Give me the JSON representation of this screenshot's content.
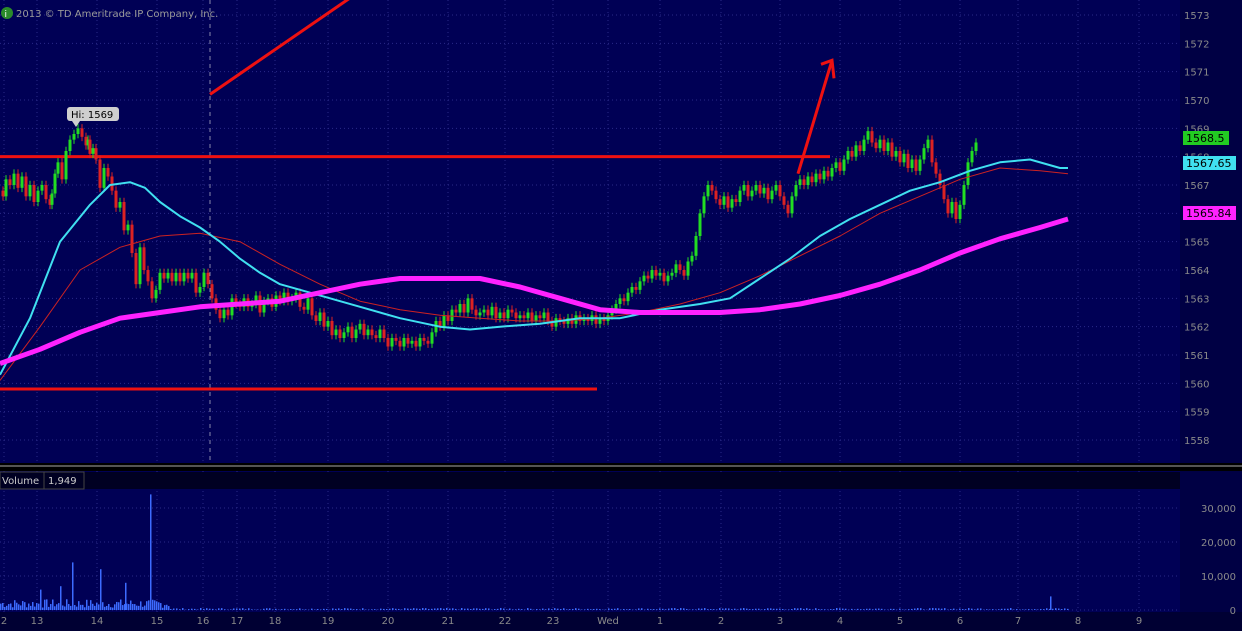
{
  "copyright": "2013 © TD Ameritrade IP Company, Inc.",
  "colors": {
    "background": "#000055",
    "grid": "#2a2a88",
    "axis_text": "#8a8a8a",
    "up_bar": "#22dd22",
    "down_bar": "#dd2222",
    "ma_fast": "#40e0f0",
    "ma_mid": "#cc2222",
    "ma_slow": "#ff22ff",
    "annotation": "#ee1111",
    "volume": "#3d6bff"
  },
  "hi_label": "Hi: 1569",
  "volume_panel": {
    "label": "Volume",
    "value": "1,949"
  },
  "price_badges": [
    {
      "text": "1568.5",
      "bg": "#22cc22",
      "fg": "#000000"
    },
    {
      "text": "1567.65",
      "bg": "#40e0f0",
      "fg": "#000000"
    },
    {
      "text": "1565.84",
      "bg": "#ff22ff",
      "fg": "#000000"
    }
  ],
  "chart_data": [
    {
      "type": "candlestick-with-moving-averages",
      "title": "",
      "y_axis": {
        "side": "right",
        "range": [
          1557.2,
          1573.5
        ],
        "ticks": [
          "1573",
          "1572",
          "1571",
          "1570",
          "1569",
          "1568",
          "1567",
          "1566",
          "1565",
          "1564",
          "1563",
          "1562",
          "1561",
          "1560",
          "1559",
          "1558"
        ]
      },
      "x_axis": {
        "labels": [
          "2",
          "13",
          "14",
          "15",
          "16",
          "17",
          "18",
          "19",
          "20",
          "21",
          "22",
          "23",
          "Wed",
          "1",
          "2",
          "3",
          "4",
          "5",
          "6",
          "7",
          "8",
          "9"
        ]
      },
      "price_path": {
        "x_bars": [
          0,
          3,
          6,
          10,
          14,
          18,
          22,
          26,
          30,
          34,
          38,
          42,
          46,
          50,
          52,
          55,
          58,
          62,
          66,
          70,
          74,
          78,
          82,
          86,
          88,
          90,
          93,
          96,
          100,
          104,
          108,
          112,
          116,
          120,
          124,
          128,
          132,
          136,
          140,
          144,
          148,
          152,
          156,
          160,
          164,
          168,
          172,
          176,
          180,
          184,
          188,
          192,
          196,
          200,
          204,
          208,
          212,
          216,
          220,
          224,
          228,
          232,
          236,
          240,
          244,
          248,
          252,
          256,
          260,
          264,
          268,
          272,
          276,
          280,
          284,
          288,
          292,
          296,
          300,
          304,
          308,
          312,
          316,
          320,
          324,
          328,
          332,
          336,
          340,
          344,
          348,
          352,
          356,
          360,
          364,
          368,
          372,
          376,
          380,
          384,
          388,
          392,
          396,
          400,
          404,
          408,
          412,
          416,
          420,
          424,
          428,
          432,
          436,
          440,
          444,
          448,
          452,
          456,
          460,
          464,
          468,
          472,
          476,
          480,
          484,
          488,
          492,
          496,
          500,
          504,
          508,
          512,
          516,
          520,
          524,
          528,
          532,
          536,
          540,
          544,
          548,
          552,
          556,
          560,
          564,
          568,
          572,
          576,
          580,
          584,
          588,
          592,
          596,
          600,
          604,
          608,
          612,
          616,
          620,
          624,
          628,
          632,
          636,
          640,
          644,
          648,
          652,
          656,
          660,
          664,
          668,
          672,
          676,
          680,
          684,
          688,
          692,
          696,
          700,
          704,
          708,
          712,
          716,
          720,
          724,
          728,
          732,
          736,
          740,
          744,
          748,
          752,
          756,
          760,
          764,
          768,
          772,
          776,
          780,
          784,
          788,
          792,
          796,
          800,
          804,
          808,
          812,
          816,
          820,
          824,
          828,
          832,
          836,
          840,
          844,
          848,
          852,
          856,
          860,
          864,
          868,
          872,
          876,
          880,
          884,
          888,
          892,
          896,
          900,
          904,
          908,
          912,
          916,
          920,
          924,
          928,
          932,
          936,
          940,
          944,
          948,
          952,
          956,
          960,
          964,
          968,
          972,
          976,
          980,
          984,
          988,
          992,
          996,
          1000,
          1004,
          1008,
          1012,
          1016,
          1020,
          1024,
          1028,
          1032,
          1036,
          1040,
          1044,
          1048,
          1052,
          1056,
          1060,
          1064,
          1068
        ],
        "closes": [
          1566.8,
          1566.6,
          1567.2,
          1567.0,
          1567.4,
          1566.9,
          1567.3,
          1566.6,
          1567.0,
          1566.4,
          1566.8,
          1567.0,
          1566.5,
          1566.3,
          1566.7,
          1567.4,
          1567.8,
          1567.2,
          1568.2,
          1568.6,
          1568.8,
          1569.0,
          1568.7,
          1568.4,
          1568.6,
          1568.1,
          1568.3,
          1567.9,
          1566.9,
          1567.6,
          1567.3,
          1566.8,
          1566.2,
          1566.4,
          1565.4,
          1565.6,
          1564.6,
          1563.5,
          1564.8,
          1564.0,
          1563.6,
          1563.0,
          1563.3,
          1563.9,
          1563.7,
          1563.9,
          1563.6,
          1563.9,
          1563.6,
          1563.9,
          1563.7,
          1563.9,
          1563.2,
          1563.4,
          1563.9,
          1563.5,
          1563.0,
          1562.6,
          1562.3,
          1562.6,
          1562.4,
          1563.0,
          1562.8,
          1562.7,
          1563.0,
          1562.7,
          1562.8,
          1563.1,
          1562.5,
          1562.9,
          1563.0,
          1562.7,
          1563.1,
          1562.9,
          1563.2,
          1562.9,
          1563.0,
          1563.2,
          1562.7,
          1562.6,
          1563.0,
          1562.4,
          1562.2,
          1562.5,
          1562.0,
          1562.2,
          1561.7,
          1561.9,
          1561.6,
          1561.8,
          1562.0,
          1561.6,
          1561.9,
          1562.1,
          1561.7,
          1561.9,
          1561.7,
          1561.6,
          1561.9,
          1561.6,
          1561.3,
          1561.6,
          1561.5,
          1561.3,
          1561.6,
          1561.4,
          1561.5,
          1561.3,
          1561.6,
          1561.5,
          1561.4,
          1561.8,
          1562.2,
          1562.0,
          1562.4,
          1562.2,
          1562.6,
          1562.5,
          1562.8,
          1562.5,
          1563.0,
          1562.6,
          1562.4,
          1562.5,
          1562.6,
          1562.4,
          1562.7,
          1562.3,
          1562.5,
          1562.3,
          1562.6,
          1562.5,
          1562.3,
          1562.4,
          1562.3,
          1562.5,
          1562.2,
          1562.4,
          1562.3,
          1562.5,
          1562.2,
          1562.0,
          1562.3,
          1562.2,
          1562.1,
          1562.3,
          1562.1,
          1562.4,
          1562.2,
          1562.3,
          1562.2,
          1562.4,
          1562.1,
          1562.3,
          1562.2,
          1562.4,
          1562.6,
          1562.8,
          1563.0,
          1562.9,
          1563.2,
          1563.4,
          1563.3,
          1563.6,
          1563.8,
          1563.7,
          1564.0,
          1563.8,
          1563.9,
          1563.6,
          1563.8,
          1563.9,
          1564.2,
          1564.0,
          1563.8,
          1564.3,
          1564.5,
          1565.2,
          1566.0,
          1566.6,
          1567.0,
          1566.8,
          1566.5,
          1566.3,
          1566.6,
          1566.2,
          1566.5,
          1566.4,
          1566.8,
          1567.0,
          1566.6,
          1566.8,
          1567.0,
          1566.7,
          1566.9,
          1566.5,
          1566.8,
          1567.0,
          1566.6,
          1566.3,
          1566.0,
          1566.6,
          1567.0,
          1567.2,
          1567.0,
          1567.3,
          1567.1,
          1567.4,
          1567.2,
          1567.5,
          1567.3,
          1567.6,
          1567.8,
          1567.5,
          1567.9,
          1568.2,
          1568.0,
          1568.4,
          1568.2,
          1568.6,
          1568.9,
          1568.5,
          1568.3,
          1568.6,
          1568.2,
          1568.5,
          1568.0,
          1568.2,
          1567.8,
          1568.1,
          1567.6,
          1567.9,
          1567.5,
          1567.9,
          1568.3,
          1568.6,
          1567.8,
          1567.4,
          1567.0,
          1566.5,
          1566.0,
          1566.4,
          1565.8,
          1566.3,
          1567.0,
          1567.8,
          1568.2,
          1568.5
        ]
      },
      "moving_averages": [
        {
          "color_key": "ma_fast",
          "x": [
            0,
            30,
            60,
            90,
            110,
            130,
            145,
            160,
            180,
            200,
            220,
            240,
            260,
            280,
            300,
            330,
            360,
            400,
            440,
            470,
            500,
            540,
            580,
            620,
            660,
            700,
            730,
            760,
            790,
            820,
            850,
            880,
            910,
            940,
            970,
            1000,
            1030,
            1060,
            1068
          ],
          "y": [
            1560.3,
            1562.3,
            1565.0,
            1566.3,
            1567.0,
            1567.1,
            1566.9,
            1566.4,
            1565.9,
            1565.5,
            1565.0,
            1564.4,
            1563.9,
            1563.5,
            1563.3,
            1563.0,
            1562.7,
            1562.3,
            1562.0,
            1561.9,
            1562.0,
            1562.1,
            1562.3,
            1562.3,
            1562.6,
            1562.8,
            1563.0,
            1563.7,
            1564.4,
            1565.2,
            1565.8,
            1566.3,
            1566.8,
            1567.1,
            1567.5,
            1567.8,
            1567.9,
            1567.6,
            1567.6
          ]
        },
        {
          "color_key": "ma_mid",
          "x": [
            0,
            40,
            80,
            120,
            160,
            200,
            240,
            280,
            320,
            360,
            400,
            440,
            480,
            520,
            560,
            600,
            640,
            680,
            720,
            760,
            800,
            840,
            880,
            920,
            960,
            1000,
            1040,
            1068
          ],
          "y": [
            1560.1,
            1562.0,
            1564.0,
            1564.8,
            1565.2,
            1565.3,
            1565.0,
            1564.2,
            1563.5,
            1562.9,
            1562.6,
            1562.4,
            1562.3,
            1562.2,
            1562.2,
            1562.3,
            1562.5,
            1562.8,
            1563.2,
            1563.8,
            1564.5,
            1565.2,
            1566.0,
            1566.6,
            1567.2,
            1567.6,
            1567.5,
            1567.4
          ]
        },
        {
          "color_key": "ma_slow",
          "x": [
            0,
            40,
            80,
            120,
            160,
            200,
            240,
            280,
            320,
            360,
            400,
            440,
            480,
            520,
            560,
            600,
            640,
            680,
            720,
            760,
            800,
            840,
            880,
            920,
            960,
            1000,
            1040,
            1068
          ],
          "y": [
            1560.7,
            1561.2,
            1561.8,
            1562.3,
            1562.5,
            1562.7,
            1562.8,
            1562.9,
            1563.2,
            1563.5,
            1563.7,
            1563.7,
            1563.7,
            1563.4,
            1563.0,
            1562.6,
            1562.5,
            1562.5,
            1562.5,
            1562.6,
            1562.8,
            1563.1,
            1563.5,
            1564.0,
            1564.6,
            1565.1,
            1565.5,
            1565.8
          ]
        }
      ],
      "annotations": {
        "horizontal_lines": [
          {
            "y": 1568.0,
            "x_range": [
              0,
              830
            ]
          },
          {
            "y": 1559.8,
            "x_range": [
              0,
              597
            ]
          }
        ],
        "trend_line": {
          "x": [
            210,
            350
          ],
          "y": [
            1570.2,
            1573.6
          ]
        },
        "arrow": {
          "x": [
            798,
            832
          ],
          "y": [
            1567.4,
            1571.4
          ]
        }
      },
      "vertical_marker_x": 210
    },
    {
      "type": "bar",
      "title": "Volume",
      "y_axis": {
        "range": [
          0,
          35000
        ],
        "ticks": [
          "30,000",
          "20,000",
          "10,000",
          "0"
        ]
      },
      "spikes": [
        {
          "x": 150,
          "value": 34000
        },
        {
          "x": 100,
          "value": 12000
        },
        {
          "x": 72,
          "value": 14000
        },
        {
          "x": 40,
          "value": 6000
        },
        {
          "x": 60,
          "value": 7000
        },
        {
          "x": 125,
          "value": 8000
        },
        {
          "x": 1050,
          "value": 4000
        }
      ]
    }
  ]
}
